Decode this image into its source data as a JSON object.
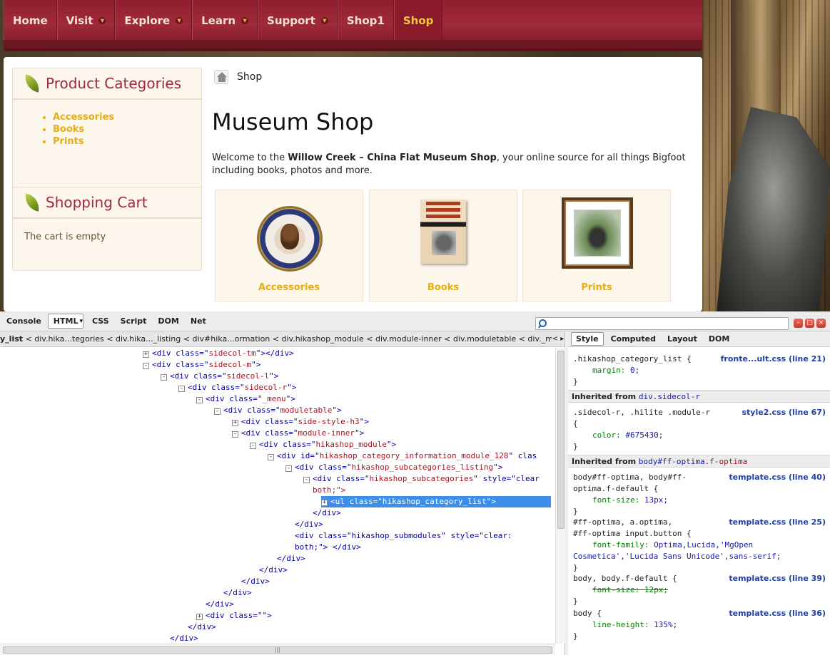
{
  "nav": {
    "items": [
      {
        "label": "Home",
        "dropdown": false,
        "active": false
      },
      {
        "label": "Visit",
        "dropdown": true,
        "active": false
      },
      {
        "label": "Explore",
        "dropdown": true,
        "active": false
      },
      {
        "label": "Learn",
        "dropdown": true,
        "active": false
      },
      {
        "label": "Support",
        "dropdown": true,
        "active": false
      },
      {
        "label": "Shop1",
        "dropdown": false,
        "active": false
      },
      {
        "label": "Shop",
        "dropdown": false,
        "active": true
      }
    ],
    "colors": {
      "bar": "#8f1f2e",
      "active_text": "#f6c544"
    }
  },
  "sidebar": {
    "categories_title": "Product Categories",
    "categories": [
      "Accessories",
      "Books",
      "Prints"
    ],
    "cart_title": "Shopping Cart",
    "cart_text": "The cart is empty"
  },
  "main": {
    "breadcrumb": "Shop",
    "title": "Museum Shop",
    "intro_before": "Welcome to the ",
    "intro_bold": "Willow Creek – China Flat Museum Shop",
    "intro_after": ", your online source for all things Bigfoot including books, photos and more.",
    "tiles": [
      {
        "label": "Accessories",
        "image": "bigfoot-lives-badge"
      },
      {
        "label": "Books",
        "image": "bigfoot-sasquatch-evidence-book"
      },
      {
        "label": "Prints",
        "image": "framed-bigfoot-print"
      }
    ],
    "accent_color": "#e6ad14"
  },
  "devtools": {
    "tabs": [
      "Console",
      "HTML",
      "CSS",
      "Script",
      "DOM",
      "Net"
    ],
    "active_tab": "HTML",
    "search_value": "",
    "breadcrumb": {
      "current": "y_list",
      "path": [
        "div.hika...tegories",
        "div.hika..._listing",
        "div#hika...ormation",
        "div.hikashop_module",
        "div.module-inner",
        "div.moduletable",
        "div._menu"
      ]
    },
    "tree": [
      {
        "indent": 0,
        "toggle": "+",
        "tag": "div",
        "attr": "class",
        "value": "sidecol-tm",
        "close": "></div>"
      },
      {
        "indent": 0,
        "toggle": "-",
        "tag": "div",
        "attr": "class",
        "value": "sidecol-m",
        "close": ">"
      },
      {
        "indent": 1,
        "toggle": "-",
        "tag": "div",
        "attr": "class",
        "value": "sidecol-l",
        "close": ">"
      },
      {
        "indent": 2,
        "toggle": "-",
        "tag": "div",
        "attr": "class",
        "value": "sidecol-r",
        "close": ">"
      },
      {
        "indent": 3,
        "toggle": "-",
        "tag": "div",
        "attr": "class",
        "value": "_menu",
        "close": ">"
      },
      {
        "indent": 4,
        "toggle": "-",
        "tag": "div",
        "attr": "class",
        "value": "moduletable",
        "close": ">"
      },
      {
        "indent": 5,
        "toggle": "+",
        "tag": "div",
        "attr": "class",
        "value": "side-style-h3",
        "close": ">"
      },
      {
        "indent": 5,
        "toggle": "-",
        "tag": "div",
        "attr": "class",
        "value": "module-inner",
        "close": ">"
      },
      {
        "indent": 6,
        "toggle": "-",
        "tag": "div",
        "attr": "class",
        "value": "hikashop_module",
        "close": ">"
      },
      {
        "indent": 7,
        "toggle": "-",
        "tag": "div",
        "attr": "id",
        "value": "hikashop_category_information_module_128",
        "close": " clas"
      },
      {
        "indent": 8,
        "toggle": "-",
        "tag": "div",
        "attr": "class",
        "value": "hikashop_subcategories_listing",
        "close": ">"
      },
      {
        "indent": 9,
        "toggle": "-",
        "tag": "div",
        "attr": "class",
        "value": "hikashop_subcategories",
        "close": " style=\"clear"
      }
    ],
    "tree_cont": "both;\">",
    "tree_selected": {
      "tag": "ul",
      "attr": "class",
      "value": "hikashop_category_list",
      "close": ">"
    },
    "tree_tail": [
      {
        "indent": 9,
        "text": "</div>"
      },
      {
        "indent": 8,
        "text": "</div>"
      },
      {
        "indent": 8,
        "text": "<div class=\"hikashop_submodules\" style=\"clear:"
      },
      {
        "indent": 8,
        "text": "both;\">  </div>"
      },
      {
        "indent": 7,
        "text": "</div>"
      },
      {
        "indent": 6,
        "text": "</div>"
      },
      {
        "indent": 5,
        "text": "</div>"
      },
      {
        "indent": 4,
        "text": "</div>"
      },
      {
        "indent": 3,
        "text": "</div>"
      },
      {
        "indent": 3,
        "text": "<div class=\"\">",
        "toggle": "+"
      },
      {
        "indent": 2,
        "text": "</div>"
      },
      {
        "indent": 1,
        "text": "</div>"
      }
    ],
    "side_tabs": [
      "Style",
      "Computed",
      "Layout",
      "DOM"
    ],
    "rules": {
      "r1_selector": ".hikashop_category_list {",
      "r1_prop": "margin:",
      "r1_value": "0;",
      "r1_source": "fronte...ult.css (line 21)",
      "inh1_label": "Inherited from ",
      "inh1_selector": "div.sidecol-r",
      "r2_selector": ".sidecol-r, .hilite .module-r",
      "r2_open": "{",
      "r2_prop": "color:",
      "r2_value": "#675430;",
      "r2_source": "style2.css (line 67)",
      "inh2_label": "Inherited from ",
      "inh2_selector": "body#ff-optima",
      "inh2_selector2": ".f-optima",
      "r3_selector": "body#ff-optima, body#ff-",
      "r3_selector2": "optima.f-default {",
      "r3_prop": "font-size:",
      "r3_value": "13px;",
      "r3_source": "template.css (line 40)",
      "r4_selector": "#ff-optima, a.optima,",
      "r4_selector2": "#ff-optima input.button {",
      "r4_prop": "font-family:",
      "r4_value": "Optima,Lucida,'MgOpen",
      "r4_value2": "Cosmetica','Lucida Sans Unicode',sans-serif;",
      "r4_source": "template.css (line 25)",
      "r5_selector": "body, body.f-default {",
      "r5_prop": "font-size: 12px;",
      "r5_source": "template.css (line 39)",
      "r6_selector": "body {",
      "r6_prop": "line-height:",
      "r6_value": "135%;",
      "r6_source": "template.css (line 36)",
      "close_brace": "}"
    }
  }
}
